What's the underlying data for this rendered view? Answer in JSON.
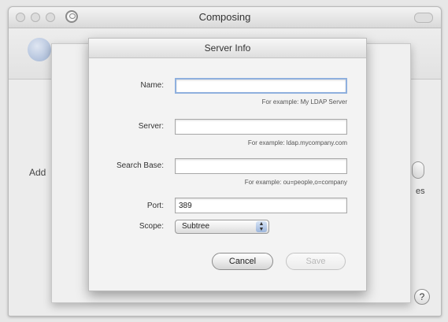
{
  "window": {
    "title": "Composing"
  },
  "background": {
    "label_add": "Add",
    "label_es": "es"
  },
  "dialog": {
    "title": "Server Info",
    "fields": {
      "name": {
        "label": "Name:",
        "value": "",
        "hint": "For example:  My LDAP Server"
      },
      "server": {
        "label": "Server:",
        "value": "",
        "hint": "For example:  ldap.mycompany.com"
      },
      "search_base": {
        "label": "Search Base:",
        "value": "",
        "hint": "For example:  ou=people,o=company"
      },
      "port": {
        "label": "Port:",
        "value": "389"
      },
      "scope": {
        "label": "Scope:",
        "value": "Subtree"
      }
    },
    "buttons": {
      "cancel": "Cancel",
      "save": "Save"
    }
  },
  "help": {
    "label": "?"
  },
  "icons": [
    "close-icon",
    "minimize-icon",
    "zoom-icon",
    "gear-icon",
    "preferences-icon",
    "popup-arrows-icon",
    "help-icon"
  ]
}
